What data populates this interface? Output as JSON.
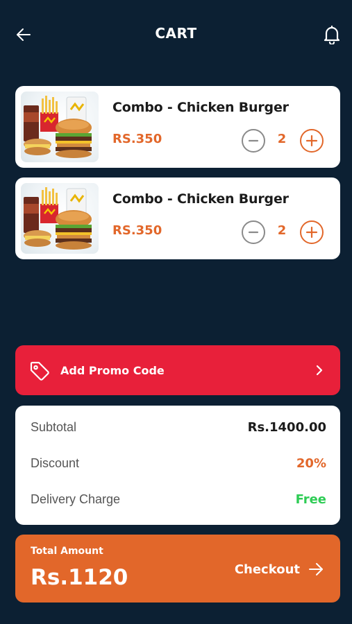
{
  "header": {
    "title": "CART",
    "back_icon": "arrow-left-icon",
    "bell_icon": "bell-icon"
  },
  "cart": {
    "items": [
      {
        "name": "Combo - Chicken Burger",
        "price": "RS.350",
        "quantity": "2",
        "image": "burger-combo-image"
      },
      {
        "name": "Combo - Chicken Burger",
        "price": "RS.350",
        "quantity": "2",
        "image": "burger-combo-image"
      }
    ]
  },
  "promo": {
    "label": "Add Promo Code",
    "icon": "tag-icon",
    "chevron_icon": "chevron-right-icon"
  },
  "summary": {
    "subtotal_label": "Subtotal",
    "subtotal_value": "Rs.1400.00",
    "discount_label": "Discount",
    "discount_value": "20%",
    "delivery_label": "Delivery Charge",
    "delivery_value": "Free"
  },
  "total": {
    "label": "Total Amount",
    "value": "Rs.1120",
    "checkout_label": "Checkout",
    "checkout_icon": "arrow-right-icon"
  },
  "colors": {
    "background": "#0c2033",
    "accent_orange": "#e2672a",
    "promo_red": "#e8203a",
    "free_green": "#2ecc55"
  }
}
